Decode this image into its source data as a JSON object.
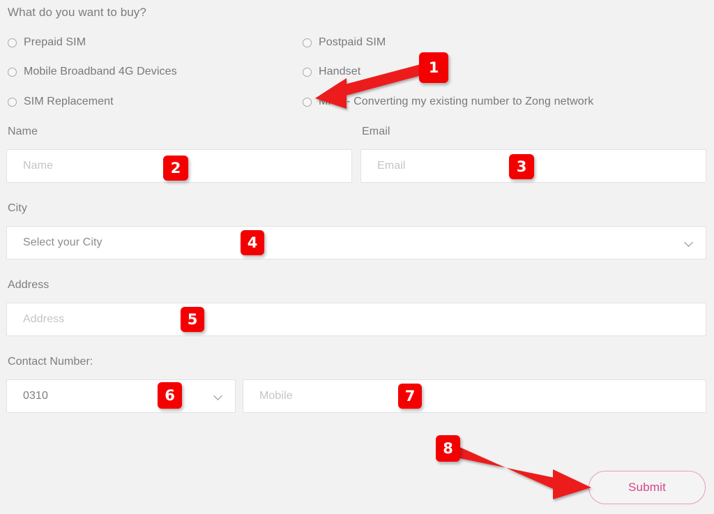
{
  "page": {
    "background_color": "#f2f2f2",
    "question_title": "What do you want to buy?"
  },
  "purchase_options": {
    "left_column": [
      {
        "label": "Prepaid SIM",
        "selected": false
      },
      {
        "label": "Mobile Broadband 4G Devices",
        "selected": false
      },
      {
        "label": "SIM Replacement",
        "selected": false
      }
    ],
    "right_column": [
      {
        "label": "Postpaid SIM",
        "selected": false
      },
      {
        "label": "Handset",
        "selected": false
      },
      {
        "label": "MNP - Converting my existing number to Zong network",
        "selected": false
      }
    ]
  },
  "fields": {
    "name": {
      "label": "Name",
      "value": "",
      "placeholder": "Name"
    },
    "email": {
      "label": "Email",
      "value": "",
      "placeholder": "Email"
    },
    "city": {
      "label": "City",
      "selected": "Select your City"
    },
    "address": {
      "label": "Address",
      "value": "",
      "placeholder": "Address"
    },
    "contact": {
      "label": "Contact Number:",
      "prefix_selected": "0310",
      "mobile_value": "",
      "mobile_placeholder": "Mobile"
    }
  },
  "actions": {
    "submit_label": "Submit",
    "submit_text_color": "#d2458c",
    "submit_border_color": "#e59cc1"
  },
  "annotations": {
    "accent_color": "#f40000",
    "markers": [
      {
        "id": "1",
        "label": "1",
        "target": "mnp-radio"
      },
      {
        "id": "2",
        "label": "2",
        "target": "name-input"
      },
      {
        "id": "3",
        "label": "3",
        "target": "email-input"
      },
      {
        "id": "4",
        "label": "4",
        "target": "city-select"
      },
      {
        "id": "5",
        "label": "5",
        "target": "address-input"
      },
      {
        "id": "6",
        "label": "6",
        "target": "contact-prefix-select"
      },
      {
        "id": "7",
        "label": "7",
        "target": "mobile-input"
      },
      {
        "id": "8",
        "label": "8",
        "target": "submit-button"
      }
    ]
  }
}
